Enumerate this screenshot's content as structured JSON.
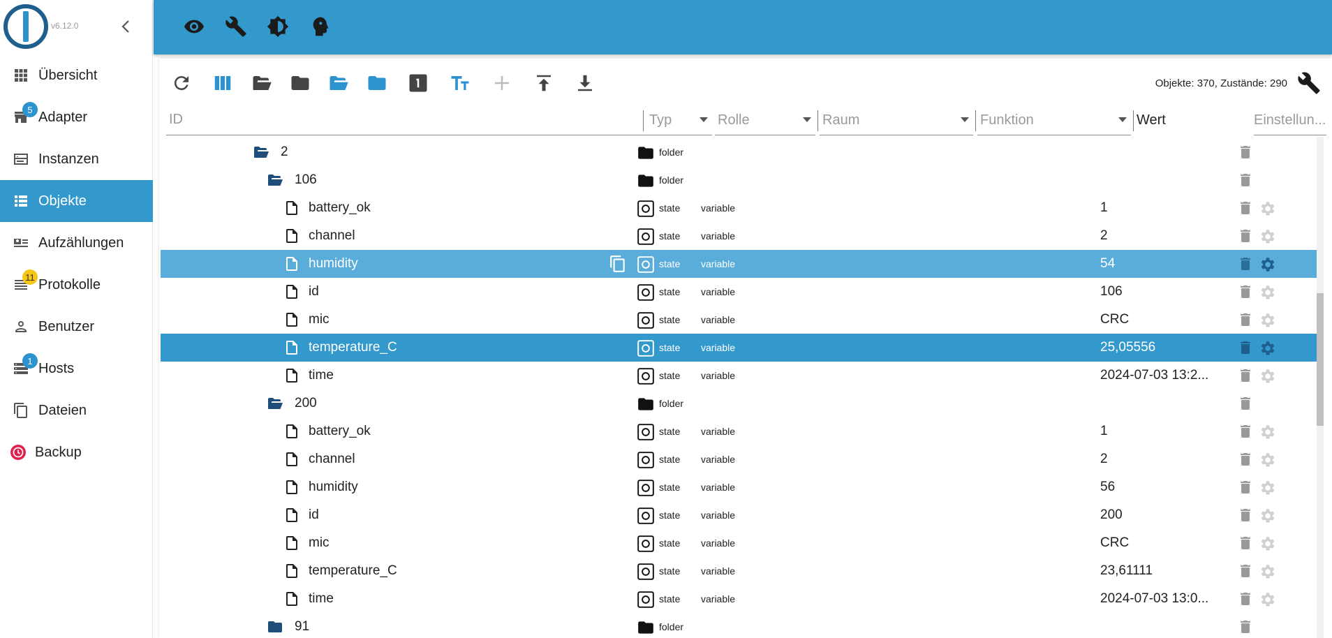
{
  "app": {
    "version": "v6.12.0",
    "accent": "#3399cc",
    "brand_dark": "#1f5f8e"
  },
  "sidebar": {
    "items": [
      {
        "label": "Übersicht",
        "icon": "apps-icon",
        "active": false
      },
      {
        "label": "Adapter",
        "icon": "store-icon",
        "badge": "5",
        "badge_color": "blue",
        "active": false
      },
      {
        "label": "Instanzen",
        "icon": "instances-icon",
        "active": false
      },
      {
        "label": "Objekte",
        "icon": "list-icon",
        "active": true
      },
      {
        "label": "Aufzählungen",
        "icon": "enum-icon",
        "active": false
      },
      {
        "label": "Protokolle",
        "icon": "logs-icon",
        "badge": "11",
        "badge_color": "yellow",
        "active": false
      },
      {
        "label": "Benutzer",
        "icon": "user-icon",
        "active": false
      },
      {
        "label": "Hosts",
        "icon": "hosts-icon",
        "badge": "1",
        "badge_color": "blue",
        "active": false
      },
      {
        "label": "Dateien",
        "icon": "files-icon",
        "active": false
      },
      {
        "label": "Backup",
        "icon": "backup-icon",
        "active": false
      }
    ]
  },
  "header": {
    "buttons": [
      "eye-icon",
      "wrench-icon",
      "theme-icon",
      "expert-icon"
    ]
  },
  "toolbar": {
    "counts": "Objekte: 370, Zustände: 290"
  },
  "filters": {
    "id_placeholder": "ID",
    "type": "Typ",
    "role": "Rolle",
    "room": "Raum",
    "function": "Funktion",
    "value": "Wert",
    "settings": "Einstellun..."
  },
  "rows": [
    {
      "name": "2",
      "kind": "folder-open",
      "level": 0,
      "type": "folder",
      "role": "",
      "value": ""
    },
    {
      "name": "106",
      "kind": "folder-open",
      "level": 1,
      "type": "folder",
      "role": "",
      "value": ""
    },
    {
      "name": "battery_ok",
      "kind": "file",
      "level": 2,
      "type": "state",
      "role": "variable",
      "value": "1"
    },
    {
      "name": "channel",
      "kind": "file",
      "level": 2,
      "type": "state",
      "role": "variable",
      "value": "2"
    },
    {
      "name": "humidity",
      "kind": "file",
      "level": 2,
      "type": "state",
      "role": "variable",
      "value": "54",
      "highlight": "light"
    },
    {
      "name": "id",
      "kind": "file",
      "level": 2,
      "type": "state",
      "role": "variable",
      "value": "106"
    },
    {
      "name": "mic",
      "kind": "file",
      "level": 2,
      "type": "state",
      "role": "variable",
      "value": "CRC"
    },
    {
      "name": "temperature_C",
      "kind": "file",
      "level": 2,
      "type": "state",
      "role": "variable",
      "value": "25,05556",
      "highlight": "selected"
    },
    {
      "name": "time",
      "kind": "file",
      "level": 2,
      "type": "state",
      "role": "variable",
      "value": "2024-07-03 13:2..."
    },
    {
      "name": "200",
      "kind": "folder-open",
      "level": 1,
      "type": "folder",
      "role": "",
      "value": ""
    },
    {
      "name": "battery_ok",
      "kind": "file",
      "level": 2,
      "type": "state",
      "role": "variable",
      "value": "1"
    },
    {
      "name": "channel",
      "kind": "file",
      "level": 2,
      "type": "state",
      "role": "variable",
      "value": "2"
    },
    {
      "name": "humidity",
      "kind": "file",
      "level": 2,
      "type": "state",
      "role": "variable",
      "value": "56"
    },
    {
      "name": "id",
      "kind": "file",
      "level": 2,
      "type": "state",
      "role": "variable",
      "value": "200"
    },
    {
      "name": "mic",
      "kind": "file",
      "level": 2,
      "type": "state",
      "role": "variable",
      "value": "CRC"
    },
    {
      "name": "temperature_C",
      "kind": "file",
      "level": 2,
      "type": "state",
      "role": "variable",
      "value": "23,61111"
    },
    {
      "name": "time",
      "kind": "file",
      "level": 2,
      "type": "state",
      "role": "variable",
      "value": "2024-07-03 13:0..."
    },
    {
      "name": "91",
      "kind": "folder-closed",
      "level": 1,
      "type": "folder",
      "role": "",
      "value": ""
    }
  ]
}
